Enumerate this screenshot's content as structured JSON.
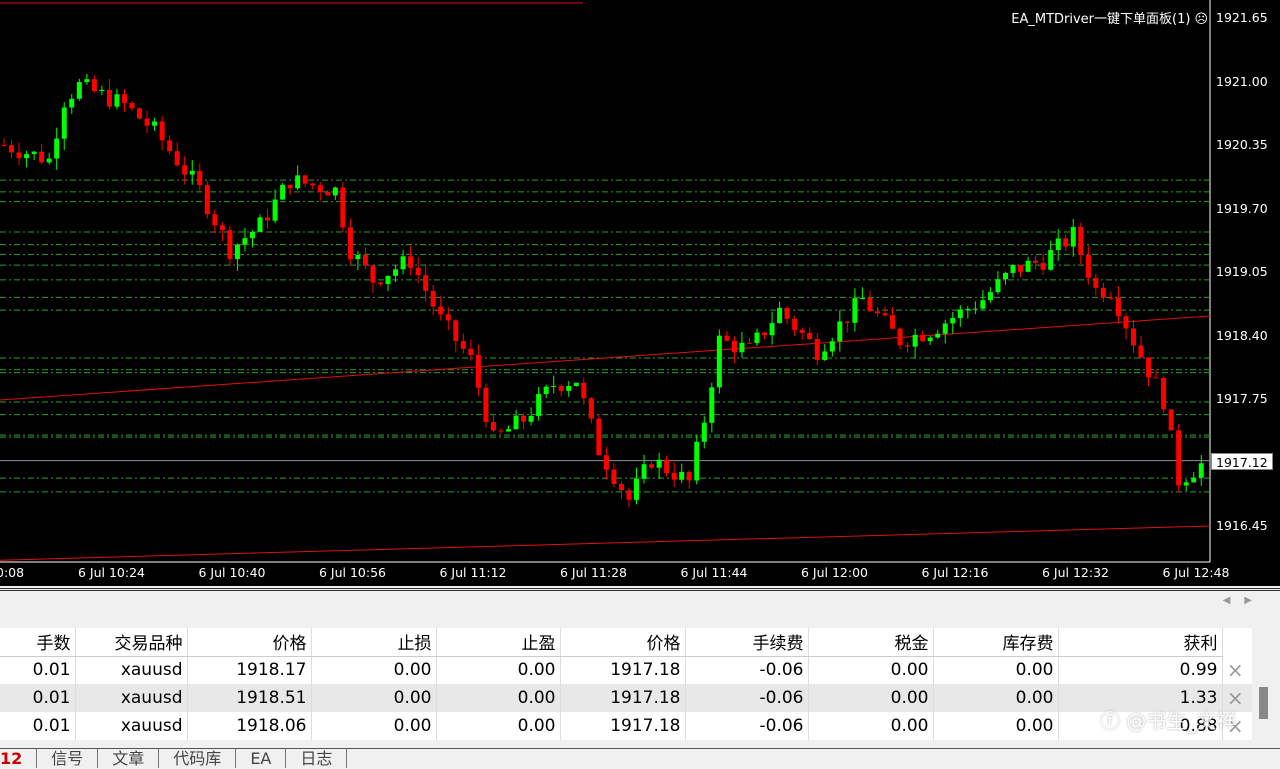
{
  "chart": {
    "indicator_label": "EA_MTDriver一键下单面板(1)",
    "indicator_icon": "sad-face-icon",
    "current_price": "1917.12",
    "price_ticks": [
      "1921.65",
      "1921.00",
      "1920.35",
      "1919.70",
      "1919.05",
      "1918.40",
      "1917.75",
      "1917.12",
      "1916.45"
    ],
    "time_ticks": [
      "0:08",
      "6 Jul 10:24",
      "6 Jul 10:40",
      "6 Jul 10:56",
      "6 Jul 11:12",
      "6 Jul 11:28",
      "6 Jul 11:44",
      "6 Jul 12:00",
      "6 Jul 12:16",
      "6 Jul 12:32",
      "6 Jul 12:48"
    ],
    "colors": {
      "bull": "#00ff00",
      "bear": "#ff0000",
      "grid": "#2e9e2e",
      "trend": "#e01010",
      "price_line": "#8c8ca0"
    },
    "levels": [
      1919.99,
      1919.87,
      1919.77,
      1919.46,
      1919.33,
      1919.23,
      1919.12,
      1918.97,
      1918.79,
      1918.66,
      1918.17,
      1918.05,
      1918.02,
      1917.72,
      1917.59,
      1917.38,
      1917.36,
      1916.94,
      1916.8
    ],
    "price_path": [
      [
        0,
        1920.35
      ],
      [
        6,
        1920.2
      ],
      [
        8,
        1920.81
      ],
      [
        10,
        1920.96
      ],
      [
        16,
        1920.76
      ],
      [
        20,
        1920.5
      ],
      [
        26,
        1919.89
      ],
      [
        30,
        1919.28
      ],
      [
        34,
        1919.53
      ],
      [
        38,
        1919.99
      ],
      [
        44,
        1919.89
      ],
      [
        46,
        1919.28
      ],
      [
        49,
        1918.97
      ],
      [
        54,
        1919.17
      ],
      [
        58,
        1918.56
      ],
      [
        62,
        1918.15
      ],
      [
        65,
        1917.33
      ],
      [
        69,
        1917.54
      ],
      [
        73,
        1917.9
      ],
      [
        76,
        1917.95
      ],
      [
        79,
        1917.23
      ],
      [
        83,
        1916.72
      ],
      [
        86,
        1917.13
      ],
      [
        91,
        1916.9
      ],
      [
        93,
        1917.54
      ],
      [
        95,
        1918.35
      ],
      [
        99,
        1918.25
      ],
      [
        103,
        1918.66
      ],
      [
        108,
        1918.25
      ],
      [
        114,
        1918.77
      ],
      [
        119,
        1918.35
      ],
      [
        123,
        1918.45
      ],
      [
        130,
        1918.77
      ],
      [
        134,
        1919.07
      ],
      [
        138,
        1919.17
      ],
      [
        142,
        1919.43
      ],
      [
        145,
        1918.87
      ],
      [
        147,
        1918.87
      ],
      [
        150,
        1918.35
      ],
      [
        154,
        1917.74
      ],
      [
        156,
        1916.92
      ],
      [
        159,
        1917.08
      ]
    ],
    "trendlines": [
      [
        1917.74,
        1918.6
      ],
      [
        1916.1,
        1916.45
      ]
    ]
  },
  "table": {
    "headers": [
      "手数",
      "交易品种",
      "价格",
      "止损",
      "止盈",
      "价格",
      "手续费",
      "税金",
      "库存费",
      "获利"
    ],
    "rows": [
      [
        "0.01",
        "xauusd",
        "1918.17",
        "0.00",
        "0.00",
        "1917.18",
        "-0.06",
        "0.00",
        "0.00",
        "0.99"
      ],
      [
        "0.01",
        "xauusd",
        "1918.51",
        "0.00",
        "0.00",
        "1917.18",
        "-0.06",
        "0.00",
        "0.00",
        "1.33"
      ],
      [
        "0.01",
        "xauusd",
        "1918.06",
        "0.00",
        "0.00",
        "1917.18",
        "-0.06",
        "0.00",
        "0.00",
        "0.88"
      ]
    ],
    "close_icon": "×"
  },
  "tabs": {
    "count": "12",
    "items": [
      "信号",
      "文章",
      "代码库",
      "EA",
      "日志"
    ]
  },
  "watermark": "知乎 @书生_文祥"
}
